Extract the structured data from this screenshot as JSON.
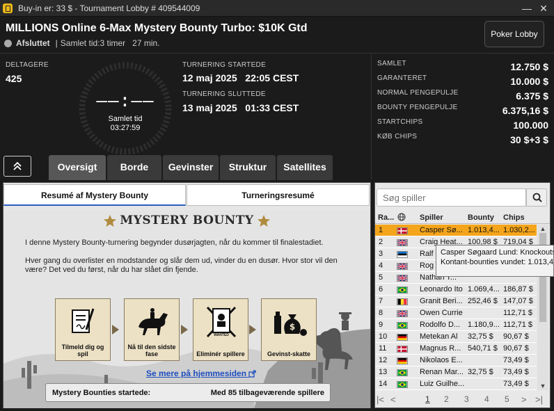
{
  "window": {
    "title": "Buy-in er: 33 $ - Tournament Lobby # 409544009",
    "minimize": "—",
    "close": "✕"
  },
  "header": {
    "title": "MILLIONS Online 6-Max Mystery Bounty Turbo: $10K Gtd",
    "status": "Afsluttet",
    "separator": "|",
    "total_time": "Samlet tid:3 timer   27 min.",
    "poker_lobby_button": "Poker Lobby"
  },
  "info": {
    "entrants_label": "DELTAGERE",
    "entrants_value": "425",
    "clock_digits": "––:––",
    "clock_label": "Samlet tid",
    "clock_time": "03:27:59",
    "start_label": "TURNERING STARTEDE",
    "start_value": "12 maj 2025   22:05 CEST",
    "end_label": "TURNERING SLUTTEDE",
    "end_value": "13 maj 2025   01:33 CEST"
  },
  "summary": [
    {
      "label": "SAMLET",
      "value": "12.750 $"
    },
    {
      "label": "GARANTERET",
      "value": "10.000 $"
    },
    {
      "label": "NORMAL PENGEPULJE",
      "value": "6.375 $"
    },
    {
      "label": "BOUNTY PENGEPULJE",
      "value": "6.375,16 $"
    },
    {
      "label": "STARTCHIPS",
      "value": "100.000"
    },
    {
      "label": "KØB CHIPS",
      "value": "30 $+3 $"
    }
  ],
  "tabs": [
    "Oversigt",
    "Borde",
    "Gevinster",
    "Struktur",
    "Satellites"
  ],
  "subtabs": [
    "Resumé af Mystery Bounty",
    "Turneringsresumé"
  ],
  "mystery": {
    "logo": "MYSTERY BOUNTY",
    "para1": "I denne Mystery Bounty-turnering begynder dusørjagten, når du kommer til finalestadiet.",
    "para2": "Hver gang du overlister en modstander og slår dem ud, vinder du en dusør. Hvor stor vil den være? Det ved du først, når du har slået din fjende.",
    "steps": [
      "Tilmeld dig og spil",
      "Nå til den sidste fase",
      "Eliminér spillere",
      "Gevinst-skatte"
    ],
    "wanted": "WANTED",
    "more_link": "Se mere på hjemmesiden",
    "started_label": "Mystery Bounties startede:",
    "started_value": "Med 85 tilbageværende spillere"
  },
  "players": {
    "search_placeholder": "Søg spiller",
    "headers": {
      "rank": "Ra...",
      "player": "Spiller",
      "bounty": "Bounty",
      "chips": "Chips"
    },
    "rows": [
      {
        "rank": "1",
        "flag": "dk",
        "player": "Casper Sø...",
        "bounty": "1.013,4...",
        "chips": "1.030,2..."
      },
      {
        "rank": "2",
        "flag": "gb",
        "player": "Craig Heat...",
        "bounty": "100,98 $",
        "chips": "719,04 $"
      },
      {
        "rank": "3",
        "flag": "ee",
        "player": "Ralf",
        "bounty": "",
        "chips": ""
      },
      {
        "rank": "4",
        "flag": "gb",
        "player": "Rog",
        "bounty": "",
        "chips": ""
      },
      {
        "rank": "5",
        "flag": "gb",
        "player": "Nathan T...",
        "bounty": "",
        "chips": ""
      },
      {
        "rank": "6",
        "flag": "br",
        "player": "Leonardo Ito",
        "bounty": "1.069,4...",
        "chips": "186,87 $"
      },
      {
        "rank": "7",
        "flag": "be",
        "player": "Granit Beri...",
        "bounty": "252,46 $",
        "chips": "147,07 $"
      },
      {
        "rank": "8",
        "flag": "gb",
        "player": "Owen Currie",
        "bounty": "",
        "chips": "112,71 $"
      },
      {
        "rank": "9",
        "flag": "br",
        "player": "Rodolfo D...",
        "bounty": "1.180,9...",
        "chips": "112,71 $"
      },
      {
        "rank": "10",
        "flag": "de",
        "player": "Metekan Al",
        "bounty": "32,75 $",
        "chips": "90,67 $"
      },
      {
        "rank": "11",
        "flag": "dk",
        "player": "Magnus R...",
        "bounty": "540,71 $",
        "chips": "90,67 $"
      },
      {
        "rank": "12",
        "flag": "de",
        "player": "Nikolaos E...",
        "bounty": "",
        "chips": "73,49 $"
      },
      {
        "rank": "13",
        "flag": "br",
        "player": "Renan Mar...",
        "bounty": "32,75 $",
        "chips": "73,49 $"
      },
      {
        "rank": "14",
        "flag": "br",
        "player": "Luiz Guilhe...",
        "bounty": "",
        "chips": "73,49 $"
      }
    ],
    "pages": [
      "1",
      "2",
      "3",
      "4",
      "5"
    ]
  },
  "tooltip": {
    "line1": "Casper Søgaard Lund: Knockouts",
    "line2": "Kontant-bounties vundet: 1.013,4"
  },
  "colors": {
    "selected_row": "#f4a51c",
    "link": "#1e4fbf",
    "accent_tab": "#575757"
  }
}
